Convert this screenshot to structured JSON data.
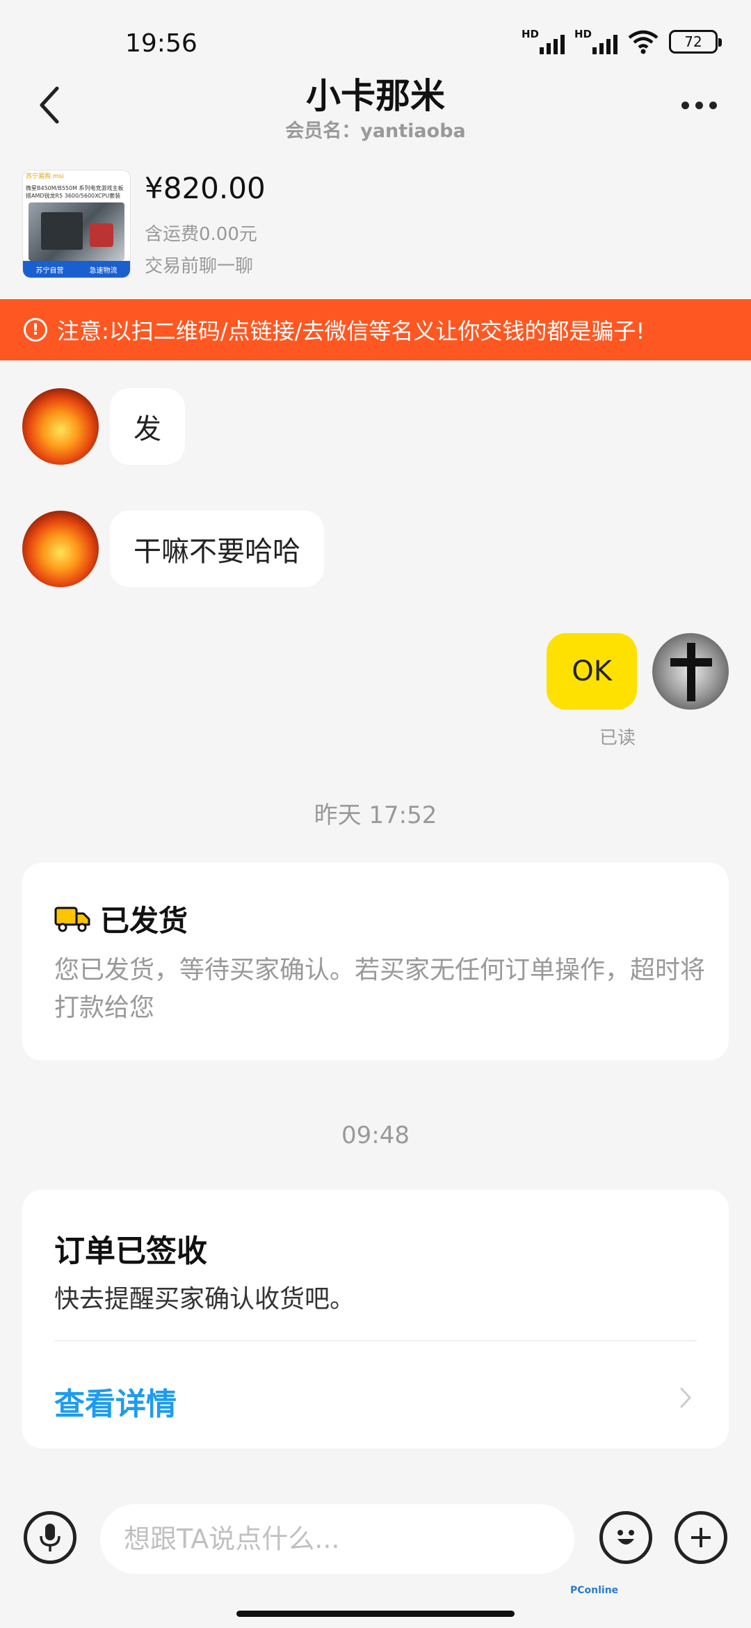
{
  "status_bar": {
    "time": "19:56",
    "signal_label": "HD",
    "battery": "72"
  },
  "header": {
    "title": "小卡那米",
    "subtitle": "会员名：yantiaoba"
  },
  "product": {
    "price": "¥820.00",
    "shipping": "含运费0.00元",
    "chat_before": "交易前聊一聊",
    "thumb_brand": "苏宁易购 msi",
    "thumb_desc": "微星B450M/B550M 系列电竞游戏主板搭AMD锐龙R5 3600/5600XCPU套装",
    "thumb_tag_left": "苏宁自营",
    "thumb_tag_right": "急速物流"
  },
  "warning": {
    "icon": "exclamation-circle-icon",
    "text": "注意:以扫二维码/点链接/去微信等名义让你交钱的都是骗子!"
  },
  "messages": [
    {
      "side": "left",
      "text": "发"
    },
    {
      "side": "left",
      "text": "干嘛不要哈哈"
    },
    {
      "side": "right",
      "text": "OK",
      "status": "已读"
    }
  ],
  "timestamps": [
    "昨天 17:52",
    "09:48"
  ],
  "shipped_card": {
    "title": "已发货",
    "icon": "truck-icon",
    "text": "您已发货，等待买家确认。若买家无任何订单操作，超时将打款给您"
  },
  "order_card": {
    "title": "订单已签收",
    "text": "快去提醒买家确认收货吧。",
    "link": "查看详情"
  },
  "input_bar": {
    "placeholder": "想跟TA说点什么..."
  },
  "watermark": "PConline",
  "colors": {
    "warning_bg": "#ff5722",
    "my_bubble": "#ffe100",
    "link": "#1e9bef"
  }
}
